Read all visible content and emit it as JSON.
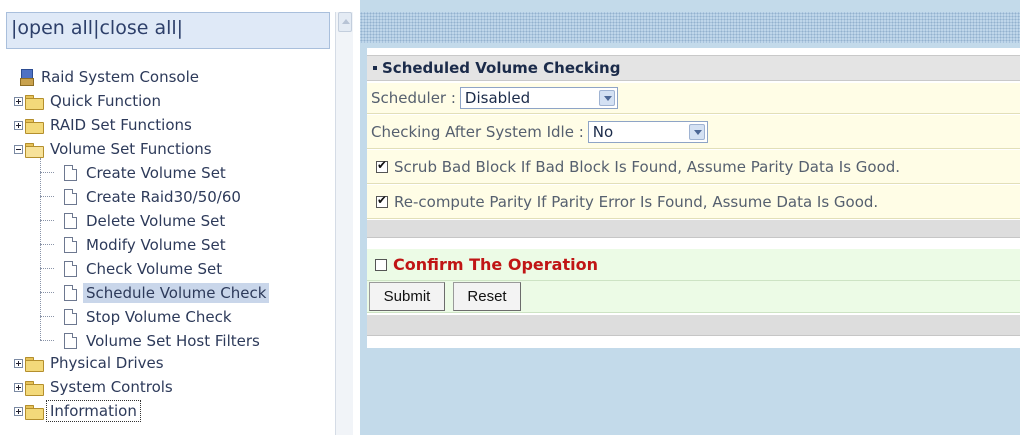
{
  "nav": {
    "header": {
      "open_all": "open all",
      "close_all": "close all",
      "separator": "|"
    },
    "root": {
      "label": "Raid System Console",
      "icon": "console-icon"
    },
    "groups": [
      {
        "label": "Quick Function",
        "icon": "folder-icon",
        "expanded": false
      },
      {
        "label": "RAID Set Functions",
        "icon": "folder-icon",
        "expanded": false
      },
      {
        "label": "Volume Set Functions",
        "icon": "folder-open-icon",
        "expanded": true,
        "children": [
          {
            "label": "Create Volume Set"
          },
          {
            "label": "Create Raid30/50/60"
          },
          {
            "label": "Delete Volume Set"
          },
          {
            "label": "Modify Volume Set"
          },
          {
            "label": "Check Volume Set"
          },
          {
            "label": "Schedule Volume Check",
            "selected": true
          },
          {
            "label": "Stop Volume Check"
          },
          {
            "label": "Volume Set Host Filters"
          }
        ]
      },
      {
        "label": "Physical Drives",
        "icon": "folder-icon",
        "expanded": false
      },
      {
        "label": "System Controls",
        "icon": "folder-icon",
        "expanded": false
      },
      {
        "label": "Information",
        "icon": "folder-icon",
        "expanded": false,
        "focused": true
      }
    ]
  },
  "form": {
    "title": "Scheduled Volume Checking",
    "scheduler": {
      "label": "Scheduler :",
      "value": "Disabled"
    },
    "idle": {
      "label": "Checking After System Idle :",
      "value": "No"
    },
    "scrub": {
      "label": "Scrub Bad Block If Bad Block Is Found, Assume Parity Data Is Good.",
      "checked": true
    },
    "recompute": {
      "label": "Re-compute Parity If Parity Error Is Found, Assume Data Is Good.",
      "checked": true
    },
    "confirm": {
      "label": "Confirm The Operation",
      "checked": false
    },
    "submit_label": "Submit",
    "reset_label": "Reset"
  },
  "colors": {
    "confirm_text": "#c01515",
    "selected_item_bg": "#c9d6ea",
    "content_bg": "#c3daea"
  }
}
